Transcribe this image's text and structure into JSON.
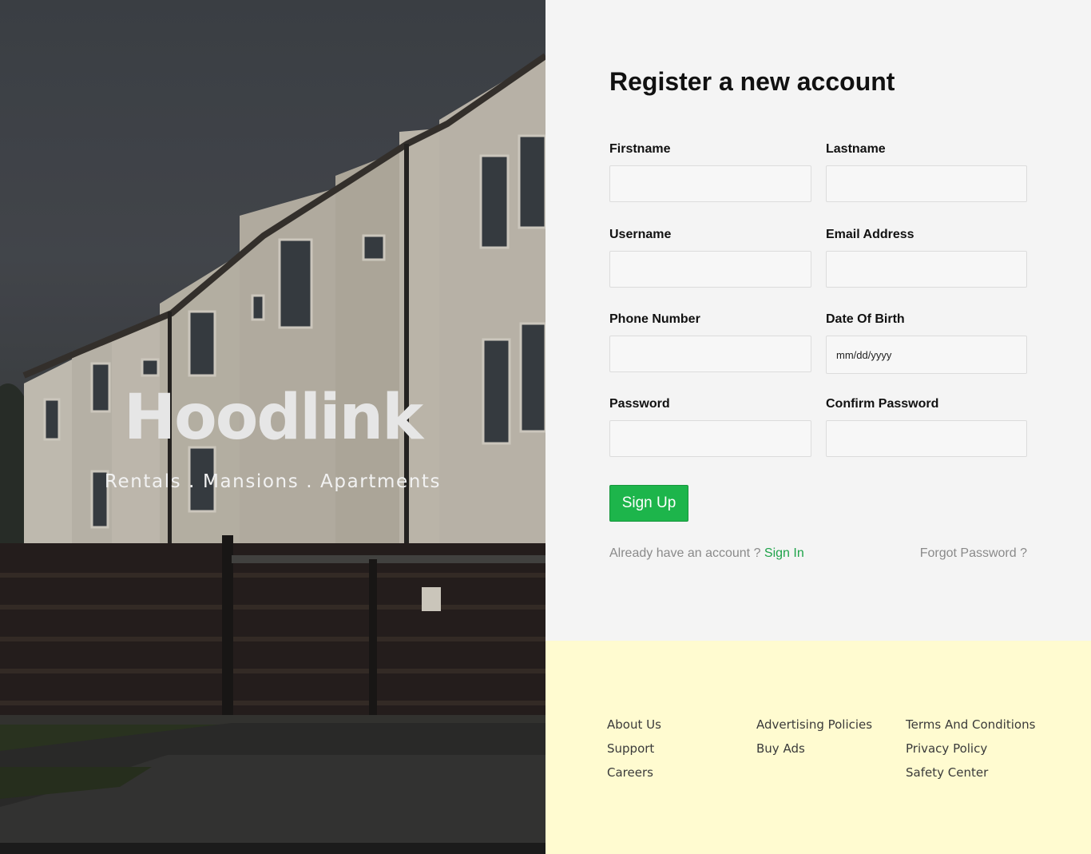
{
  "hero": {
    "brand": "Hoodlink",
    "tagline": "Rentals . Mansions . Apartments"
  },
  "form": {
    "title": "Register a new account",
    "fields": {
      "firstname": {
        "label": "Firstname",
        "value": "",
        "placeholder": ""
      },
      "lastname": {
        "label": "Lastname",
        "value": "",
        "placeholder": ""
      },
      "username": {
        "label": "Username",
        "value": "",
        "placeholder": ""
      },
      "email": {
        "label": "Email Address",
        "value": "",
        "placeholder": ""
      },
      "phone": {
        "label": "Phone Number",
        "value": "",
        "placeholder": ""
      },
      "dob": {
        "label": "Date Of Birth",
        "value": "",
        "placeholder": "mm/dd/yyyy"
      },
      "password": {
        "label": "Password",
        "value": "",
        "placeholder": ""
      },
      "confirm_password": {
        "label": "Confirm Password",
        "value": "",
        "placeholder": ""
      }
    },
    "signup_label": "Sign Up",
    "account_prompt": "Already have an account ? ",
    "signin_label": "Sign In",
    "forgot_label": "Forgot Password ?"
  },
  "footer": {
    "columns": [
      [
        "About Us",
        "Support",
        "Careers"
      ],
      [
        "Advertising Policies",
        "Buy Ads"
      ],
      [
        "Terms And Conditions",
        "Privacy Policy",
        "Safety Center"
      ]
    ]
  },
  "colors": {
    "accent": "#1db54b",
    "link": "#1fa34a",
    "footer_bg": "#fffbd0",
    "panel_bg": "#f4f4f4"
  }
}
